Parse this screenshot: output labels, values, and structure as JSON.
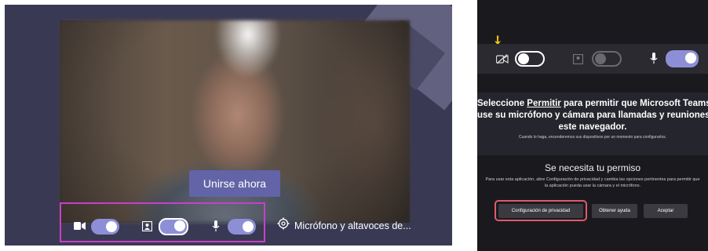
{
  "left": {
    "join_button": "Unirse ahora",
    "devices_label": "Micrófono y altavoces de...",
    "icons": [
      "camera-icon",
      "background-effects-icon",
      "microphone-icon",
      "gear-icon"
    ],
    "colors": {
      "accent": "#6264a7",
      "toggle": "#8d8fd6",
      "highlight": "#c83fc8"
    }
  },
  "right": {
    "icons": [
      "camera-off-icon",
      "background-effects-icon",
      "microphone-icon"
    ],
    "prompt_line1_pre": "Seleccione ",
    "prompt_line1_link": "Permitir",
    "prompt_line1_post": " para permitir que Microsoft Teams",
    "prompt_line2": "use su micrófono y cámara para llamadas y reuniones e",
    "prompt_line3": "este navegador.",
    "prompt_small": "Cuando lo haga, encenderemos sus dispositivos por un momento para configurarlos.",
    "perm_title": "Se necesita tu permiso",
    "perm_body": "Para usar esta aplicación, abre Configuración de privacidad y cambia las opciones pertinentes para permitir que la aplicación pueda usar la cámara y el micrófono.",
    "buttons": {
      "privacy": "Configuración de privacidad",
      "help": "Obtener ayuda",
      "accept": "Aceptar"
    },
    "colors": {
      "arrow": "#f3c21a",
      "highlight": "#e05a6a"
    }
  }
}
